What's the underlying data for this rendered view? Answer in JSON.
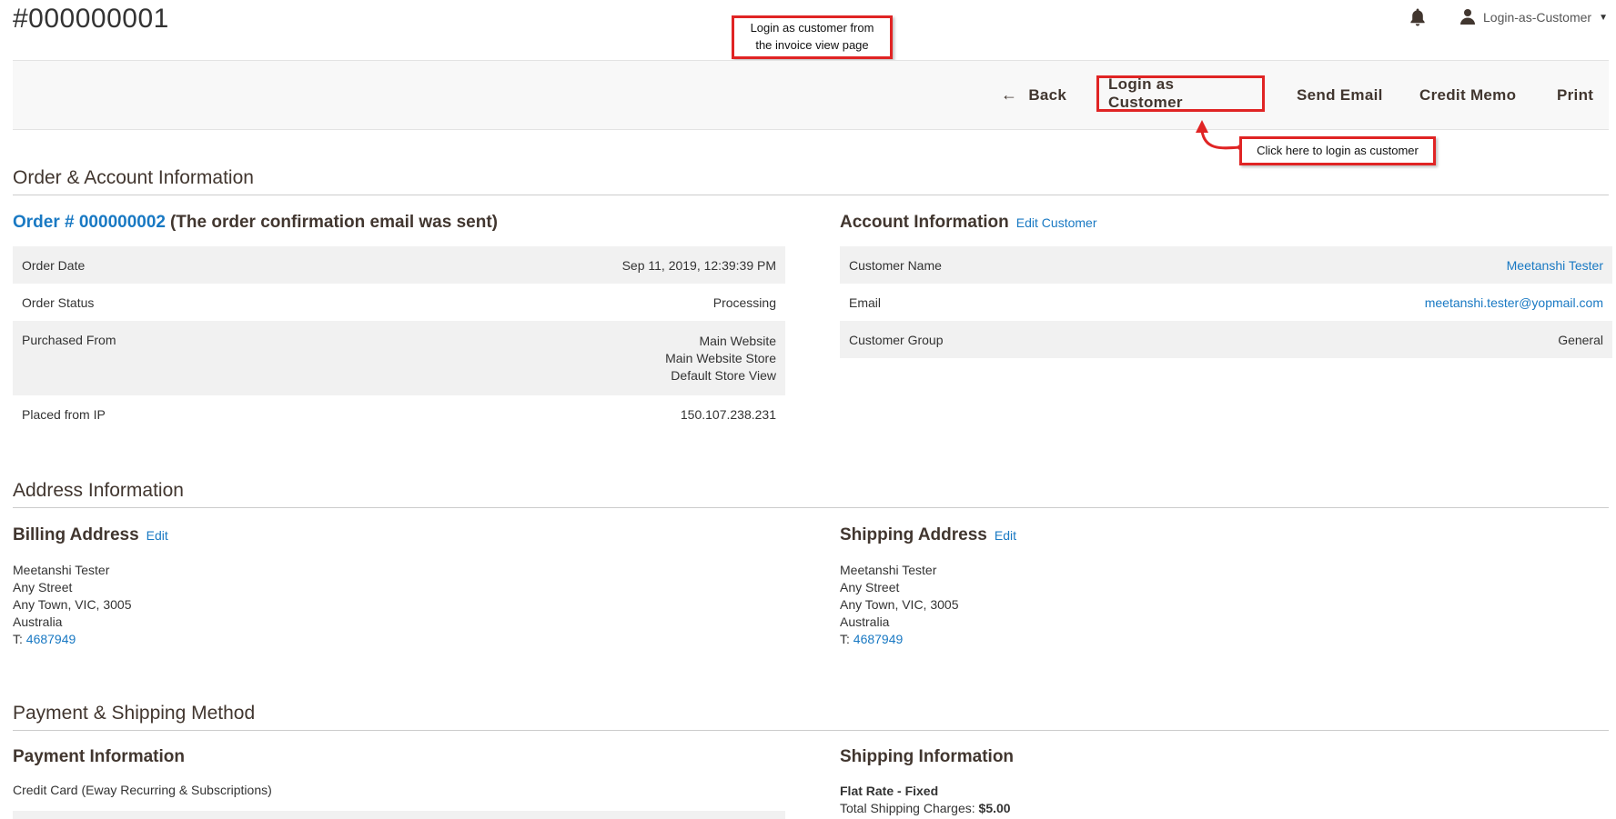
{
  "header": {
    "title": "#000000001",
    "user_name": "Login-as-Customer"
  },
  "toolbar": {
    "back_label": "Back",
    "login_label": "Login as Customer",
    "email_label": "Send Email",
    "memo_label": "Credit Memo",
    "print_label": "Print"
  },
  "annotations": {
    "top_line1": "Login as customer from",
    "top_line2": "the invoice view page",
    "click_hint": "Click here to login as customer",
    "accent_color": "#e02424"
  },
  "order_account": {
    "section_title": "Order & Account Information",
    "order_link": "Order # 000000002",
    "order_note": "(The order confirmation email was sent)",
    "order_rows": {
      "date_label": "Order Date",
      "date_value": "Sep 11, 2019, 12:39:39 PM",
      "status_label": "Order Status",
      "status_value": "Processing",
      "purchased_label": "Purchased From",
      "purchased_line1": "Main Website",
      "purchased_line2": "Main Website Store",
      "purchased_line3": "Default Store View",
      "ip_label": "Placed from IP",
      "ip_value": "150.107.238.231"
    },
    "account_title": "Account Information",
    "account_edit": "Edit Customer",
    "account_rows": {
      "name_label": "Customer Name",
      "name_value": "Meetanshi Tester",
      "email_label": "Email",
      "email_value": "meetanshi.tester@yopmail.com",
      "group_label": "Customer Group",
      "group_value": "General"
    }
  },
  "address": {
    "section_title": "Address Information",
    "billing": {
      "title": "Billing Address",
      "edit": "Edit",
      "name": "Meetanshi Tester",
      "street": "Any Street",
      "city": "Any Town, VIC, 3005",
      "country": "Australia",
      "phone_prefix": "T:",
      "phone": "4687949"
    },
    "shipping": {
      "title": "Shipping Address",
      "edit": "Edit",
      "name": "Meetanshi Tester",
      "street": "Any Street",
      "city": "Any Town, VIC, 3005",
      "country": "Australia",
      "phone_prefix": "T:",
      "phone": "4687949"
    }
  },
  "payment_shipping": {
    "section_title": "Payment & Shipping Method",
    "payment_title": "Payment Information",
    "payment_method": "Credit Card (Eway Recurring & Subscriptions)",
    "shipping_title": "Shipping Information",
    "shipping_method": "Flat Rate - Fixed",
    "shipping_charges_label": "Total Shipping Charges:",
    "shipping_charges_value": "$5.00"
  },
  "colors": {
    "link": "#1979c3",
    "heading": "#41362f",
    "row_shade": "#f1f1f1"
  },
  "icons": {
    "notification": "bell-icon",
    "user": "user-icon",
    "back": "arrow-left-icon",
    "dropdown": "caret-down-icon"
  }
}
